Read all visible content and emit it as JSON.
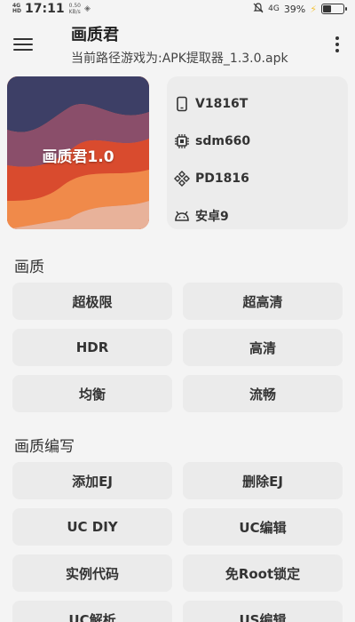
{
  "status_bar": {
    "network_top": "4G",
    "network_bottom": "HD",
    "time": "17:11",
    "speed_value": "0.50",
    "speed_unit": "KB/s",
    "data_indicator": "4G",
    "battery": "39%",
    "battery_level": 0.39
  },
  "app_bar": {
    "title": "画质君",
    "subtitle": "当前路径游戏为:APK提取器_1.3.0.apk"
  },
  "cover": {
    "label": "画质君1.0",
    "colors": [
      "#3a3f63",
      "#d94b2e",
      "#f08a4a",
      "#e8b29a"
    ]
  },
  "device_info": [
    {
      "icon": "phone-icon",
      "value": "V1816T"
    },
    {
      "icon": "chip-icon",
      "value": "sdm660"
    },
    {
      "icon": "diamond-grid-icon",
      "value": "PD1816"
    },
    {
      "icon": "android-icon",
      "value": "安卓9"
    }
  ],
  "sections": [
    {
      "title": "画质",
      "buttons": [
        "超极限",
        "超高清",
        "HDR",
        "高清",
        "均衡",
        "流畅"
      ]
    },
    {
      "title": "画质编写",
      "buttons": [
        "添加EJ",
        "删除EJ",
        "UC DIY",
        "UC编辑",
        "实例代码",
        "免Root锁定",
        "UC解析",
        "US编辑"
      ]
    }
  ]
}
